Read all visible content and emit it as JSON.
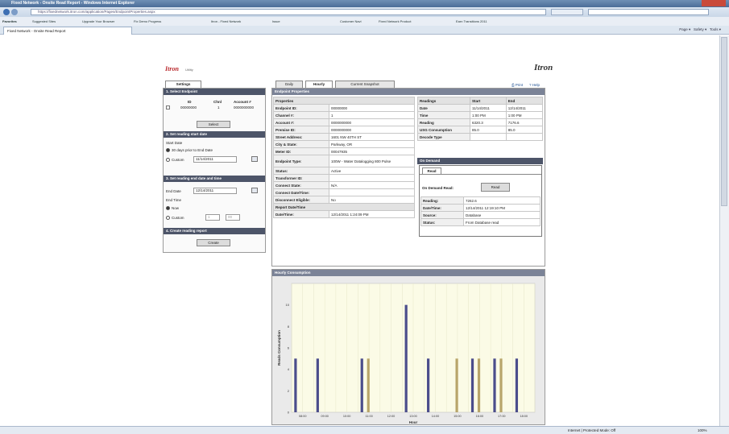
{
  "browser": {
    "title": "Fixed Network - Onsite Read Report - Windows Internet Explorer",
    "address": "https://fixednetwork.itron.com/application/Pages/EndpointProperties.aspx",
    "favorites_label": "Favorites",
    "favorites": [
      "Suggested Sites",
      "Upgrade Your Browser",
      "Fix Demo Progress",
      "Itron - Fixed Network",
      "Issue",
      "Customer Navi",
      "Fixed Network Product",
      "Earn Transitions 2011"
    ],
    "tab_label": "Fixed Network - Onsite Read Report",
    "commands": [
      "Page",
      "Safety",
      "Tools"
    ],
    "status_zone": "Internet | Protected Mode: Off",
    "zoom": "100%"
  },
  "page": {
    "logo_text": "Itron",
    "logo_sub": "Utility",
    "right_logo_text": "Itron",
    "print_link": "Print",
    "help_link": "Help"
  },
  "settings": {
    "tab_label": "Settings",
    "s1_title": "1. Select Endpoint",
    "ep_headers": [
      "ID",
      "Chnl",
      "Account #"
    ],
    "ep_values": [
      "00000000",
      "1",
      "0000000000"
    ],
    "select_btn": "Select",
    "s2_title": "2. Set reading start date",
    "start_date_label": "Start Date",
    "opt_30days": "30 days prior to End Date",
    "opt_custom": "Custom",
    "custom_date": "11/14/2011",
    "s3_title": "3. Set reading end date and time",
    "end_date_label": "End Date",
    "end_date": "12/14/2011",
    "end_time_label": "End Time",
    "opt_now": "Now",
    "opt_custom2": "Custom",
    "custom_time_h": "1",
    "custom_time_m": "00",
    "s4_title": "4. Create reading report",
    "create_btn": "Create"
  },
  "tabs": [
    {
      "label": "Daily"
    },
    {
      "label": "Hourly"
    },
    {
      "label": "Current Snapshot"
    }
  ],
  "endpoint": {
    "header": "Endpoint Properties",
    "props_header": "Properties",
    "rows": [
      {
        "k": "Endpoint ID:",
        "v": "00000000"
      },
      {
        "k": "Channel #:",
        "v": "1"
      },
      {
        "k": "Account #:",
        "v": "0000000000"
      },
      {
        "k": "Premise ID:",
        "v": "0000000000"
      },
      {
        "k": "Street Address:",
        "v": "1601 NW 40TH ST"
      },
      {
        "k": "City & State:",
        "v": "Parkway, OR"
      },
      {
        "k": "Meter ID:",
        "v": "00047935"
      },
      {
        "k": "Endpoint Type:",
        "v": "100W - Water Datalogging 800 Pulse"
      },
      {
        "k": "Status:",
        "v": "Active"
      },
      {
        "k": "Transformer ID:",
        "v": ""
      },
      {
        "k": "Connect State:",
        "v": "N/A"
      },
      {
        "k": "Connect Date/Time:",
        "v": ""
      },
      {
        "k": "Disconnect Eligible:",
        "v": "No"
      }
    ],
    "report_header": "Report Date/Time",
    "report_k": "Date/Time:",
    "report_v": "12/14/2011 1:24:09 PM"
  },
  "readings": {
    "headers": [
      "Readings",
      "Start",
      "End"
    ],
    "rows": [
      {
        "k": "Date",
        "s": "11/14/2011",
        "e": "12/14/2011"
      },
      {
        "k": "Time",
        "s": "1:00 PM",
        "e": "1:00 PM"
      },
      {
        "k": "Reading",
        "s": "6320.3",
        "e": "7176.6"
      },
      {
        "k": "USG Consumption",
        "s": "85.0",
        "e": "85.0"
      },
      {
        "k": "Decode Type",
        "s": "",
        "e": ""
      }
    ],
    "ondemand_header": "On Demand",
    "ondemand_tab": "Read",
    "ondemand_label": "On Demand Read:",
    "read_btn": "Read",
    "od_rows": [
      {
        "k": "Reading:",
        "v": "7262.6"
      },
      {
        "k": "Date/Time:",
        "v": "12/14/2011 12:19:10 PM"
      },
      {
        "k": "Source:",
        "v": "Database"
      },
      {
        "k": "Status:",
        "v": "From Database read"
      }
    ]
  },
  "chart_panel": {
    "header": "Hourly Consumption"
  },
  "chart_data": {
    "type": "bar",
    "title": "",
    "xlabel": "Hour",
    "ylabel": "Reads Consumption",
    "ylim": [
      0,
      12
    ],
    "yticks": [
      "0",
      "2",
      "4",
      "6",
      "8",
      "10"
    ],
    "categories": [
      "08:00",
      "09:00",
      "10:00",
      "11:00",
      "12:00",
      "13:00",
      "14:00",
      "15:00",
      "16:00",
      "17:00",
      "18:00"
    ],
    "series": [
      {
        "color": "#4b4d8c",
        "values": [
          5,
          5,
          0,
          5,
          0,
          10,
          5,
          0,
          5,
          5,
          5
        ]
      },
      {
        "color": "#b8a56a",
        "values": [
          0,
          0,
          0,
          5,
          0,
          0,
          0,
          5,
          5,
          5,
          0
        ]
      }
    ],
    "grid": true,
    "background": "#fbfbe6"
  }
}
